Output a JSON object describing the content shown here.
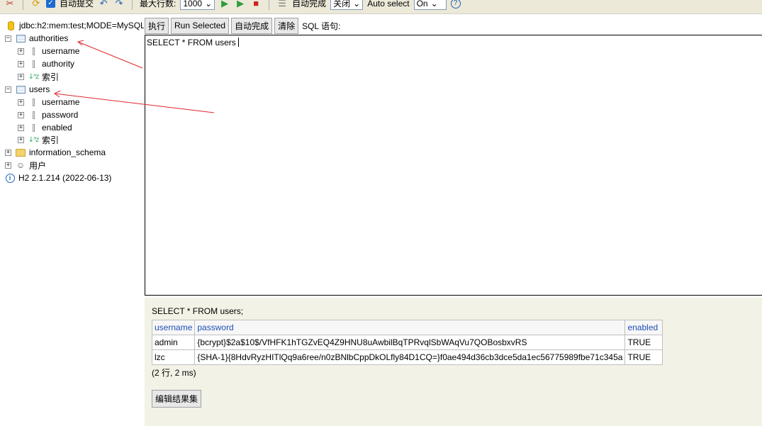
{
  "toolbar": {
    "autocommit_label": "自动提交",
    "maxrows_label": "最大行数:",
    "maxrows_value": "1000",
    "autocomplete_label": "自动完成",
    "autocomplete_value": "关闭",
    "autoselect_label": "Auto select",
    "autoselect_value": "On"
  },
  "tree": {
    "connection": "jdbc:h2:mem:test;MODE=MySQL",
    "tables": [
      {
        "name": "authorities",
        "columns": [
          "username",
          "authority"
        ],
        "index_label": "索引"
      },
      {
        "name": "users",
        "columns": [
          "username",
          "password",
          "enabled"
        ],
        "index_label": "索引"
      }
    ],
    "schema": "information_schema",
    "users_node": "用户",
    "version": "H2 2.1.214 (2022-06-13)"
  },
  "query": {
    "execute_label": "执行",
    "run_selected_label": "Run Selected",
    "autocomplete_label": "自动完成",
    "clear_label": "清除",
    "sql_label": "SQL 语句:",
    "sql_text": "SELECT * FROM users"
  },
  "results": {
    "sql": "SELECT * FROM users;",
    "columns": [
      "username",
      "password",
      "enabled"
    ],
    "rows": [
      [
        "admin",
        "{bcrypt}$2a$10$/VfHFK1hTGZvEQ4Z9HNU8uAwbilBqTPRvqlSbWAqVu7QOBosbxvRS",
        "TRUE"
      ],
      [
        "lzc",
        "{SHA-1}{8HdvRyzHITlQq9a6ree/n0zBNlbCppDkOLfly84D1CQ=}f0ae494d36cb3dce5da1ec56775989fbe71c345a",
        "TRUE"
      ]
    ],
    "row_count": "(2 行, 2 ms)",
    "edit_label": "编辑结果集"
  }
}
